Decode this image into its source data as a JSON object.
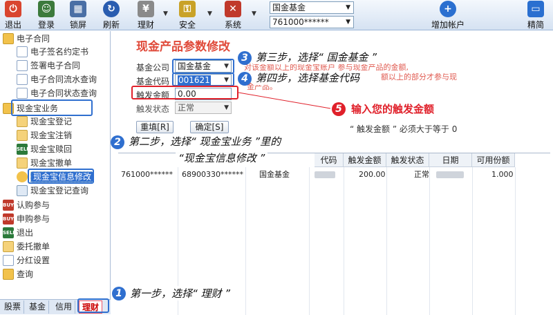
{
  "toolbar": {
    "items": [
      {
        "label": "退出",
        "icon": "power-icon",
        "color": "#d9452f"
      },
      {
        "label": "登录",
        "icon": "user-group-icon",
        "color": "#3c7a3c"
      },
      {
        "label": "锁屏",
        "icon": "building-lock-icon",
        "color": "#4a6fa5"
      },
      {
        "label": "刷新",
        "icon": "refresh-icon",
        "color": "#2a5db0"
      },
      {
        "label": "理财",
        "icon": "finance-icon",
        "color": "#777777"
      },
      {
        "label": "安全",
        "icon": "key-icon",
        "color": "#c9a227"
      },
      {
        "label": "系统",
        "icon": "tools-icon",
        "color": "#c0392b"
      }
    ],
    "account_type": "国金基金",
    "account_number": "761000******",
    "add_account_label": "增加帐户",
    "simple_label": "精简"
  },
  "tree": {
    "contract_group": "电子合同",
    "contract_items": [
      "电子签名约定书",
      "签署电子合同",
      "电子合同流水查询",
      "电子合同状态查询"
    ],
    "cash_group": "现金宝业务",
    "cash_items": [
      "现金宝登记",
      "现金宝注销",
      "现金宝赎回",
      "现金宝撤单",
      "现金宝信息修改",
      "现金宝登记查询"
    ],
    "other_items": [
      "认购参与",
      "申购参与",
      "退出",
      "委托撤单",
      "分红设置",
      "查询"
    ],
    "buy_icon_text": "BUY",
    "sell_icon_text": "SELL"
  },
  "tabs": [
    "股票",
    "基金",
    "信用",
    "理财"
  ],
  "form": {
    "title": "现金产品参数修改",
    "company_label": "基金公司",
    "company_value": "国金基金",
    "code_label": "基金代码",
    "code_value": "001621",
    "trigger_amount_label": "触发金额",
    "trigger_amount_value": "0.00",
    "trigger_status_label": "触发状态",
    "trigger_status_value": "正常",
    "reset_button": "重填[R]",
    "confirm_button": "确定[S]",
    "hint_line1": "对该金额以上的现金宝账户 参与现金产品的金额,",
    "hint_line2": "额以上的部分才参与现",
    "hint_line3": "金产品。"
  },
  "grid": {
    "headers": [
      "代码",
      "触发金额",
      "触发状态",
      "日期",
      "可用份额"
    ],
    "row": {
      "account": "761000******",
      "number": "68900330******",
      "company": "国金基金",
      "amount": "200.00",
      "status": "正常",
      "available": "1.000"
    }
  },
  "annotations": {
    "step1": {
      "num": "1",
      "text": "第一步，选择“ 理财 ”"
    },
    "step2": {
      "num": "2",
      "line1": "第二步，选择“ 现金宝业务 ”里的",
      "line2": "“现金宝信息修改 ”"
    },
    "step3": {
      "num": "3",
      "text": "第三步，选择“ 国金基金 ”"
    },
    "step4": {
      "num": "4",
      "text": "第四步，选择基金代码"
    },
    "step5": {
      "num": "5",
      "text": "输入您的触发金额"
    },
    "note": "“ 触发金额 ” 必须大于等于 0"
  }
}
